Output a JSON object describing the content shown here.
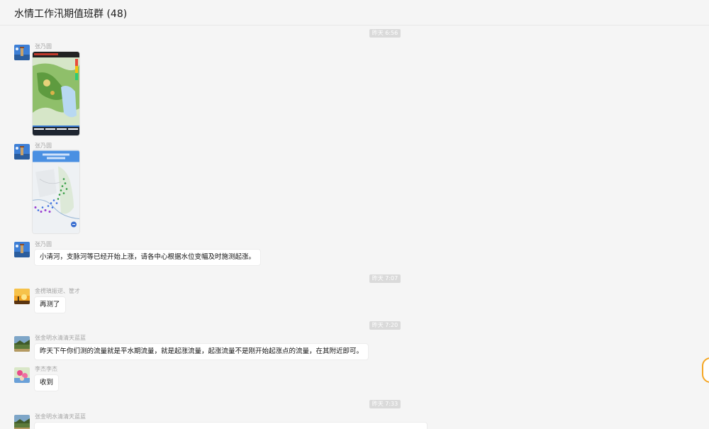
{
  "header": {
    "title": "水情工作汛期值班群 (48)"
  },
  "time_separators": [
    "昨天 6:56",
    "昨天 7:07",
    "昨天 7:20",
    "昨天 7:33"
  ],
  "messages": [
    {
      "sender": "张乃圆",
      "avatar_icon": "tower-avatar-icon",
      "type": "image",
      "image_icon": "radar-map-image"
    },
    {
      "sender": "张乃圆",
      "avatar_icon": "tower-avatar-icon",
      "type": "image",
      "image_icon": "station-map-image"
    },
    {
      "sender": "张乃圆",
      "avatar_icon": "tower-avatar-icon",
      "type": "text",
      "text": "小清河，支脉河等已经开始上涨，请各中心根据水位变幅及时施测起涨。"
    },
    {
      "sender": "金楞瑱振逆、筐才",
      "avatar_icon": "sunset-avatar-icon",
      "type": "text",
      "text": "再测了"
    },
    {
      "sender": "张金明水清清天蓝蓝",
      "avatar_icon": "landscape-avatar-icon",
      "type": "text",
      "text": "昨天下午你们测的流量就是平水期流量，就是起涨流量，起涨流量不是刚开始起涨点的流量，在其附近即可。"
    },
    {
      "sender": "李杰李杰",
      "avatar_icon": "flower-avatar-icon",
      "type": "text",
      "text": "收到"
    },
    {
      "sender": "张金明水清清天蓝蓝",
      "avatar_icon": "landscape-avatar-icon",
      "type": "text",
      "text": ""
    }
  ],
  "colors": {
    "background": "#f5f5f5",
    "bubble": "#ffffff",
    "time_badge": "#dadada",
    "side_button": "#f5a623"
  }
}
